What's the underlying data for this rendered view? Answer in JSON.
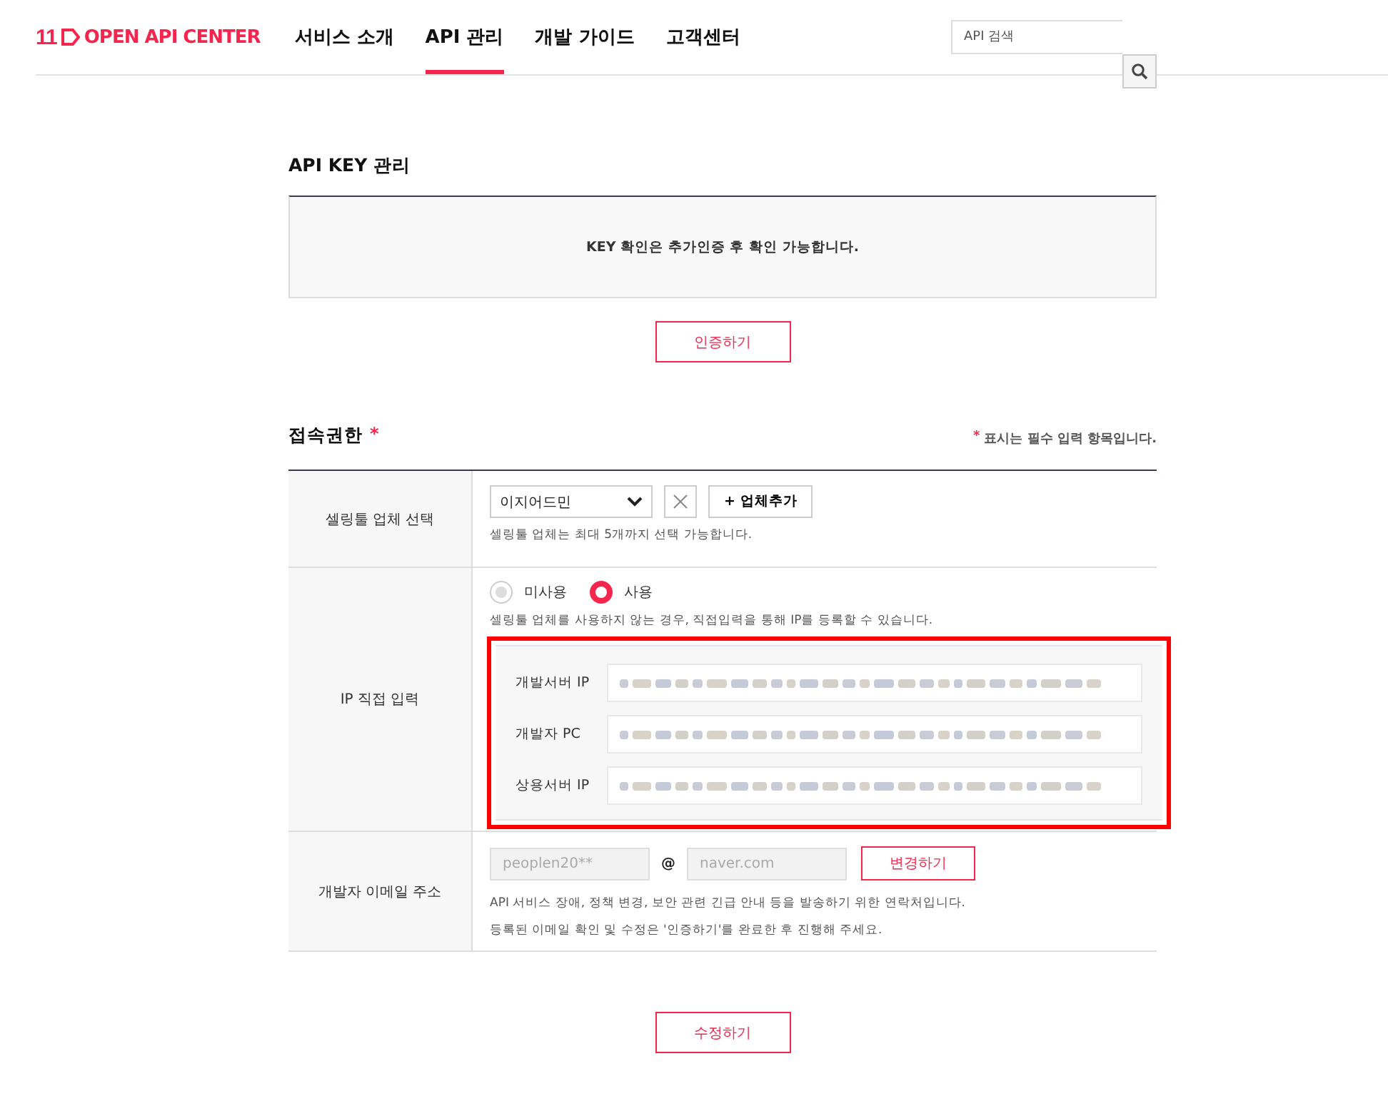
{
  "header": {
    "logo_mark": "11",
    "logo_text": "OPEN API CENTER",
    "nav": [
      {
        "label": "서비스 소개",
        "selected": false
      },
      {
        "label": "API 관리",
        "selected": true
      },
      {
        "label": "개발 가이드",
        "selected": false
      },
      {
        "label": "고객센터",
        "selected": false
      }
    ],
    "search": {
      "placeholder": "API 검색"
    }
  },
  "api_key": {
    "title": "API KEY 관리",
    "notice": "KEY 확인은 추가인증 후 확인 가능합니다.",
    "button": "인증하기"
  },
  "access": {
    "title": "접속권한",
    "required_mark": "*",
    "required_note_mark": "*",
    "required_note": "표시는 필수 입력 항목입니다.",
    "seller_tool": {
      "label": "셀링툴 업체 선택",
      "select_value": "이지어드민",
      "add_button": "+ 업체추가",
      "hint": "셀링툴 업체는 최대 5개까지 선택 가능합니다."
    },
    "ip": {
      "label": "IP 직접 입력",
      "radios": [
        {
          "label": "미사용",
          "selected": false
        },
        {
          "label": "사용",
          "selected": true
        }
      ],
      "hint": "셀링툴 업체를 사용하지 않는 경우, 직접입력을 통해 IP를 등록할 수 있습니다.",
      "highlighted": true,
      "fields": [
        {
          "label": "개발서버 IP"
        },
        {
          "label": "개발자 PC"
        },
        {
          "label": "상용서버 IP"
        }
      ]
    },
    "email": {
      "label": "개발자 이메일 주소",
      "local": "peoplen20**",
      "at": "@",
      "domain": "naver.com",
      "button": "변경하기",
      "notes": [
        "API 서비스 장애, 정책 변경, 보안 관련 긴급 안내 등을 발송하기 위한 연락처입니다.",
        "등록된 이메일 확인 및 수정은 '인증하기'를 완료한 후 진행해 주세요."
      ]
    }
  },
  "submit_button": "수정하기"
}
